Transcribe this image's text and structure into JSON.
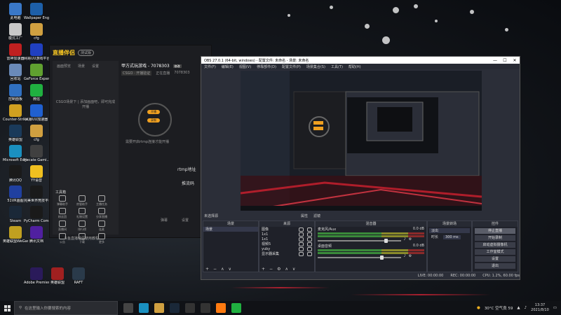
{
  "desktop": {
    "icons": [
      {
        "label": "此电脑",
        "color": "#3a78c8"
      },
      {
        "label": "Wallpaper Engine:...",
        "color": "#1d5fa8"
      },
      {
        "label": "模式工厂",
        "color": "#c8c8c8"
      },
      {
        "label": "cfg",
        "color": "#d0a040"
      },
      {
        "label": "雷神加速器",
        "color": "#c02020"
      },
      {
        "label": "网易UU游戏平台",
        "color": "#2040c0"
      },
      {
        "label": "回收站",
        "color": "#6a8ab8"
      },
      {
        "label": "GeForce Experience",
        "color": "#60a030"
      },
      {
        "label": "控制面板",
        "color": "#3070c0"
      },
      {
        "label": "微信",
        "color": "#20b040"
      },
      {
        "label": "Counter-Strike Global Off...",
        "color": "#d0a020"
      },
      {
        "label": "风暴UU加速器",
        "color": "#2060d0"
      },
      {
        "label": "英雄联盟",
        "color": "#1a3a5a"
      },
      {
        "label": "cfg",
        "color": "#d0a040"
      },
      {
        "label": "Microsoft Edge",
        "color": "#1a90c0"
      },
      {
        "label": "Hecate Gami...",
        "color": "#404040"
      },
      {
        "label": "腾讯QQ",
        "color": "#1a1a1a"
      },
      {
        "label": "YY语音",
        "color": "#f0c020"
      },
      {
        "label": "51VR画图",
        "color": "#2040a0"
      },
      {
        "label": "完美世界竞技平台",
        "color": "#1a1a1a"
      },
      {
        "label": "Steam",
        "color": "#1a2838"
      },
      {
        "label": "PyCharm Communit...",
        "color": "#1a1a1a"
      },
      {
        "label": "英雄联盟WeGame版",
        "color": "#c0a020"
      },
      {
        "label": "腾讯文档",
        "color": "#5020a0"
      },
      {
        "label": "Adobe Premiere",
        "color": "#2a1a5a"
      },
      {
        "label": "英雄联盟",
        "color": "#a02020"
      },
      {
        "label": "RAFT",
        "color": "#2a3a4a"
      }
    ]
  },
  "streaming_app": {
    "logo": "直播伴侣",
    "badge": "测试版",
    "room_title": "甲方式玩游戏 - 7078303",
    "edit": "修改",
    "game": "CSGO · 开播验证",
    "room_id_label": "正在直播",
    "room_id": "7078303",
    "tabs": [
      "画面预览",
      "场景",
      "设置"
    ],
    "scene_placeholder": "CSGO场景下 | 添加画面吧，即可完成开播",
    "live_pill_1": "开播",
    "live_pill_2": "录制",
    "live_hint": "需要开启rtmp连接才能开播",
    "rtmp_label": "rtmp地址",
    "push_code_label": "推流码",
    "tools_title": "工具箱",
    "tools": [
      "弹幕助手",
      "房管助手",
      "主播任务",
      "粉丝团",
      "礼物设置",
      "分享直播",
      "直播间",
      "排行榜",
      "连麦",
      "公告",
      "下载",
      "更多"
    ],
    "bottom_notice": "斗鱼直播伴侣使用教程",
    "footer_btns": [
      "弹幕",
      "设置"
    ]
  },
  "obs": {
    "title": "OBS 27.0.1 (64-bit, windows) - 配置文件: 未命名 - 场景: 未命名",
    "window_controls": [
      "—",
      "☐",
      "✕"
    ],
    "menu": [
      "文件(F)",
      "编辑(E)",
      "视图(V)",
      "停靠部件(D)",
      "配置文件(P)",
      "场景集合(S)",
      "工具(T)",
      "帮助(H)"
    ],
    "scene_bar": {
      "label": "未选择源",
      "props": "属性",
      "filters": "滤镜"
    },
    "docks": {
      "scenes": {
        "title": "场景",
        "items": [
          "场景"
        ]
      },
      "sources": {
        "title": "来源",
        "items": [
          "图像",
          "1x1",
          "1x1",
          "视频5",
          "yuby",
          "显示器采集"
        ]
      },
      "mixer": {
        "title": "混音器",
        "channels": [
          {
            "name": "麦克风/Aux",
            "db": "0.0 dB",
            "level": 0.8
          },
          {
            "name": "桌面音频",
            "db": "0.0 dB",
            "level": 0.75
          }
        ]
      },
      "transitions": {
        "title": "场景转场",
        "type": "淡出",
        "duration_label": "时长",
        "duration": "300 ms"
      },
      "controls": {
        "title": "控件",
        "buttons": [
          "停止直播",
          "开始录制",
          "启动虚拟摄像机",
          "工作室模式",
          "设置",
          "退出"
        ]
      }
    },
    "status": {
      "live": "LIVE: 00:00:00",
      "rec": "REC: 00:00:00",
      "cpu": "CPU: 1.2%, 60.00 fps"
    }
  },
  "taskbar": {
    "search_placeholder": "在这里输入你要搜索的内容",
    "weather": "30°C 空气良 59",
    "time": "13:37",
    "date": "2021/8/10",
    "apps": [
      "task-view",
      "edge",
      "explorer",
      "steam",
      "obs",
      "obs2",
      "douyu",
      "wechat"
    ]
  }
}
